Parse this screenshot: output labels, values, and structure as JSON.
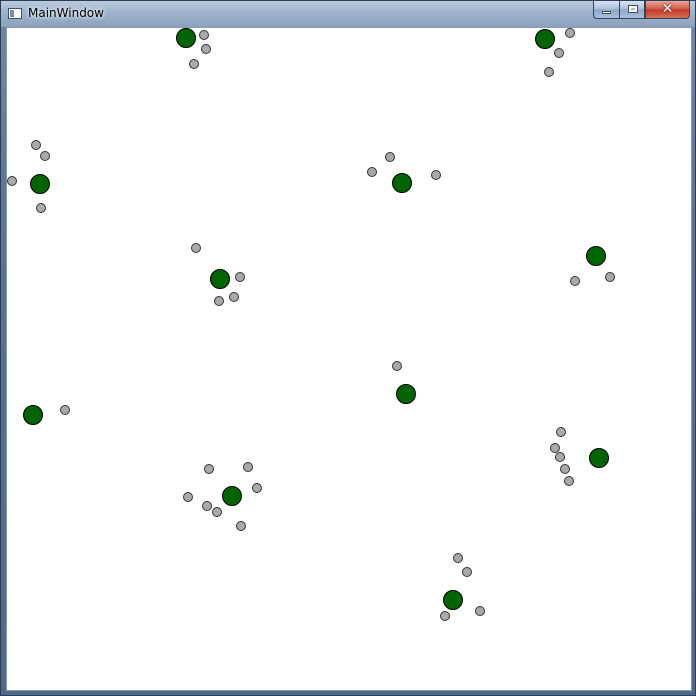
{
  "window": {
    "title": "MainWindow",
    "close_glyph": "✕",
    "icons": {
      "app": "window-icon",
      "minimize": "minimize-icon",
      "maximize": "maximize-icon",
      "close": "close-icon"
    }
  },
  "colors": {
    "node_fill": "#006400",
    "node_stroke": "#000000",
    "satellite_fill": "#a9a9a9",
    "satellite_stroke": "#333333",
    "canvas_background": "#ffffff"
  }
}
